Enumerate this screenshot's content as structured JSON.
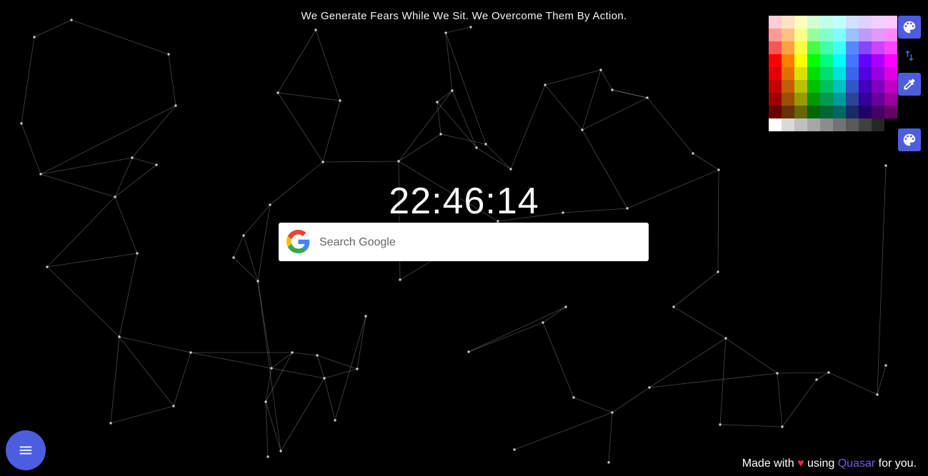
{
  "quote": "We Generate Fears While We Sit. We Overcome Them By Action.",
  "clock": "22:46:14",
  "search": {
    "placeholder": "Search Google",
    "logo_icon": "google-g-icon"
  },
  "footer": {
    "prefix": "Made with",
    "heart": "♥",
    "middle": "using",
    "brand": "Quasar",
    "suffix": "for you."
  },
  "toolbar": {
    "palette_button_icon": "palette-icon",
    "swap_icon": "swap-vertical-icon",
    "eyedropper_icon": "eyedropper-icon",
    "palette_button_2_icon": "palette-icon"
  },
  "menu_button_icon": "menu-icon",
  "accent_color": "#4d5de0",
  "palette_colors": [
    [
      "#ffcdd2",
      "#ffe0c0",
      "#ffffc0",
      "#d0ffd0",
      "#c0ffe8",
      "#c0ffff",
      "#d0e0ff",
      "#e0d0ff",
      "#f0d0ff",
      "#ffc8ff"
    ],
    [
      "#ff9999",
      "#ffc080",
      "#ffff88",
      "#99ff99",
      "#80ffcc",
      "#80ffff",
      "#99c0ff",
      "#c099ff",
      "#e099ff",
      "#ff88ff"
    ],
    [
      "#ff5555",
      "#ffa040",
      "#ffff44",
      "#44ff44",
      "#40ffaa",
      "#40ffff",
      "#5588ff",
      "#8844ff",
      "#cc44ff",
      "#ff44ff"
    ],
    [
      "#ff0000",
      "#ff8000",
      "#ffff00",
      "#00ff00",
      "#00ff80",
      "#00ffff",
      "#4477ff",
      "#6600ff",
      "#aa00ff",
      "#ff00ff"
    ],
    [
      "#e00000",
      "#e07000",
      "#e0e000",
      "#00e000",
      "#00e070",
      "#00e0e0",
      "#3a66ee",
      "#5500e0",
      "#9900e0",
      "#e000e0"
    ],
    [
      "#c00000",
      "#c06000",
      "#c0c000",
      "#00c000",
      "#00c060",
      "#00c0c0",
      "#3355cc",
      "#4400c0",
      "#8000c0",
      "#c000c0"
    ],
    [
      "#990000",
      "#995000",
      "#999900",
      "#009900",
      "#009950",
      "#009999",
      "#2a4499",
      "#330099",
      "#660099",
      "#990099"
    ],
    [
      "#660000",
      "#663300",
      "#666600",
      "#006600",
      "#006633",
      "#006666",
      "#1a2a66",
      "#220066",
      "#440066",
      "#660066"
    ],
    [
      "#ffffff",
      "#d9d9d9",
      "#bfbfbf",
      "#a6a6a6",
      "#8c8c8c",
      "#737373",
      "#595959",
      "#404040",
      "#262626",
      "#000000"
    ]
  ]
}
